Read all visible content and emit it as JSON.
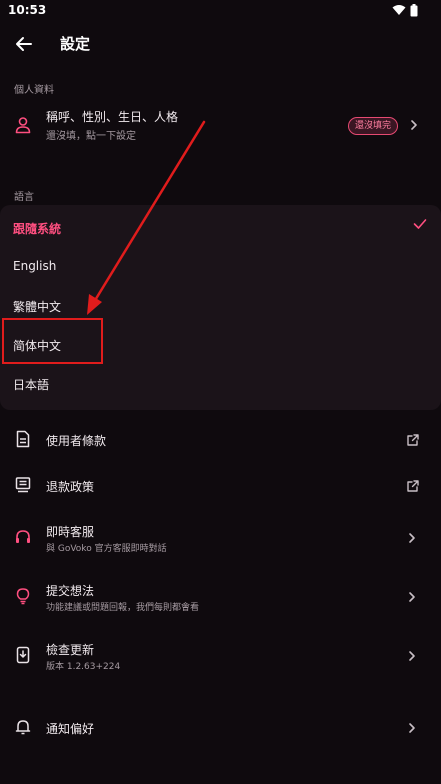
{
  "status_bar": {
    "time": "10:53",
    "wifi_icon": "wifi-icon",
    "battery_icon": "battery-icon"
  },
  "app_bar": {
    "title": "設定",
    "back_icon": "arrow-left-icon"
  },
  "profile_section": {
    "label": "個人資料",
    "row": {
      "title": "稱呼、性別、生日、人格",
      "subtitle": "還沒填，點一下設定",
      "badge": "還沒填完",
      "icon": "person-icon"
    }
  },
  "language_section": {
    "label": "語言",
    "options": [
      {
        "label": "跟隨系統",
        "selected": true
      },
      {
        "label": "English",
        "selected": false
      },
      {
        "label": "繁體中文",
        "selected": false
      },
      {
        "label": "简体中文",
        "selected": false
      },
      {
        "label": "日本語",
        "selected": false
      }
    ]
  },
  "menu": [
    {
      "title": "使用者條款",
      "subtitle": "",
      "icon": "document-icon",
      "trailing": "external-link-icon"
    },
    {
      "title": "退款政策",
      "subtitle": "",
      "icon": "receipt-icon",
      "trailing": "external-link-icon"
    },
    {
      "title": "即時客服",
      "subtitle": "與 GoVoko 官方客服即時對話",
      "icon": "headset-icon",
      "trailing": "chevron-right-icon"
    },
    {
      "title": "提交想法",
      "subtitle": "功能建議或問題回報，我們每則都會看",
      "icon": "lightbulb-icon",
      "trailing": "chevron-right-icon"
    },
    {
      "title": "檢查更新",
      "subtitle": "版本 1.2.63+224",
      "icon": "phone-download-icon",
      "trailing": "chevron-right-icon"
    },
    {
      "title": "通知偏好",
      "subtitle": "",
      "icon": "bell-icon",
      "trailing": "chevron-right-icon"
    }
  ],
  "colors": {
    "accent": "#ff4f80",
    "annotation": "#e01c1c",
    "background": "#0f0a0e",
    "panel": "#1b1319"
  }
}
